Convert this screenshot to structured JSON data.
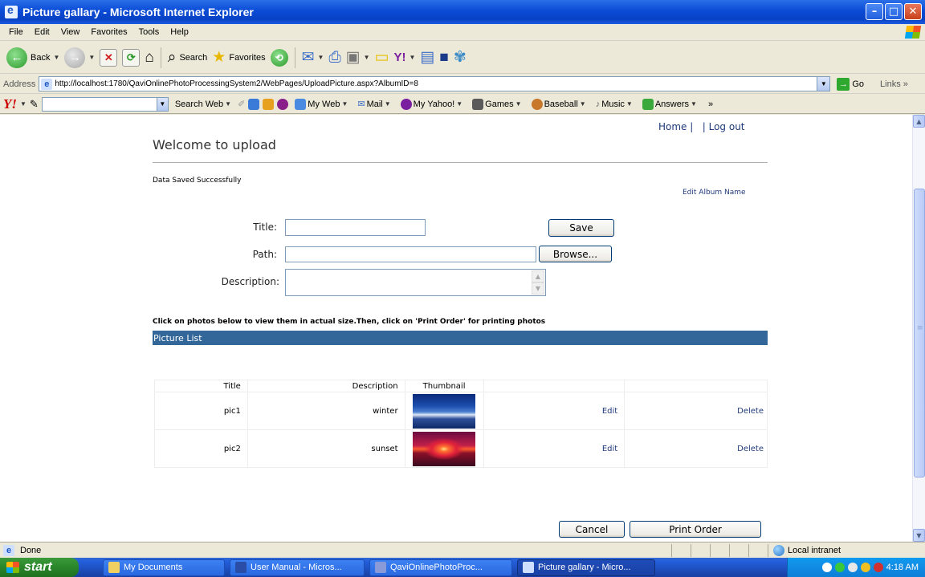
{
  "window": {
    "title": "Picture gallary - Microsoft Internet Explorer"
  },
  "menu": [
    "File",
    "Edit",
    "View",
    "Favorites",
    "Tools",
    "Help"
  ],
  "toolbar": {
    "back": "Back",
    "search": "Search",
    "favorites": "Favorites"
  },
  "address": {
    "label": "Address",
    "url": "http://localhost:1780/QaviOnlinePhotoProcessingSystem2/WebPages/UploadPicture.aspx?AlbumID=8",
    "go": "Go",
    "links": "Links"
  },
  "yahoo": {
    "search_web": "Search Web",
    "my_web": "My Web",
    "mail": "Mail",
    "my_yahoo": "My Yahoo!",
    "games": "Games",
    "baseball": "Baseball",
    "music": "Music",
    "answers": "Answers"
  },
  "page": {
    "home": "Home",
    "logout": "Log out",
    "welcome": "Welcome to upload",
    "status_message": "Data Saved Successfully",
    "edit_album": "Edit Album Name",
    "form": {
      "title_label": "Title:",
      "path_label": "Path:",
      "description_label": "Description:",
      "save": "Save",
      "browse": "Browse..."
    },
    "instructions": "Click on photos below to view them in actual size.Then, click on 'Print Order' for printing photos",
    "list_header": "Picture List",
    "columns": [
      "Title",
      "Description",
      "Thumbnail"
    ],
    "rows": [
      {
        "title": "pic1",
        "description": "winter",
        "edit": "Edit",
        "delete": "Delete"
      },
      {
        "title": "pic2",
        "description": "sunset",
        "edit": "Edit",
        "delete": "Delete"
      }
    ],
    "cancel": "Cancel",
    "print_order": "Print Order"
  },
  "status": {
    "text": "Done",
    "zone": "Local intranet"
  },
  "taskbar": {
    "start": "start",
    "tasks": [
      "My Documents",
      "User Manual - Micros...",
      "QaviOnlinePhotoProc...",
      "Picture gallary - Micro..."
    ],
    "clock": "4:18 AM"
  }
}
